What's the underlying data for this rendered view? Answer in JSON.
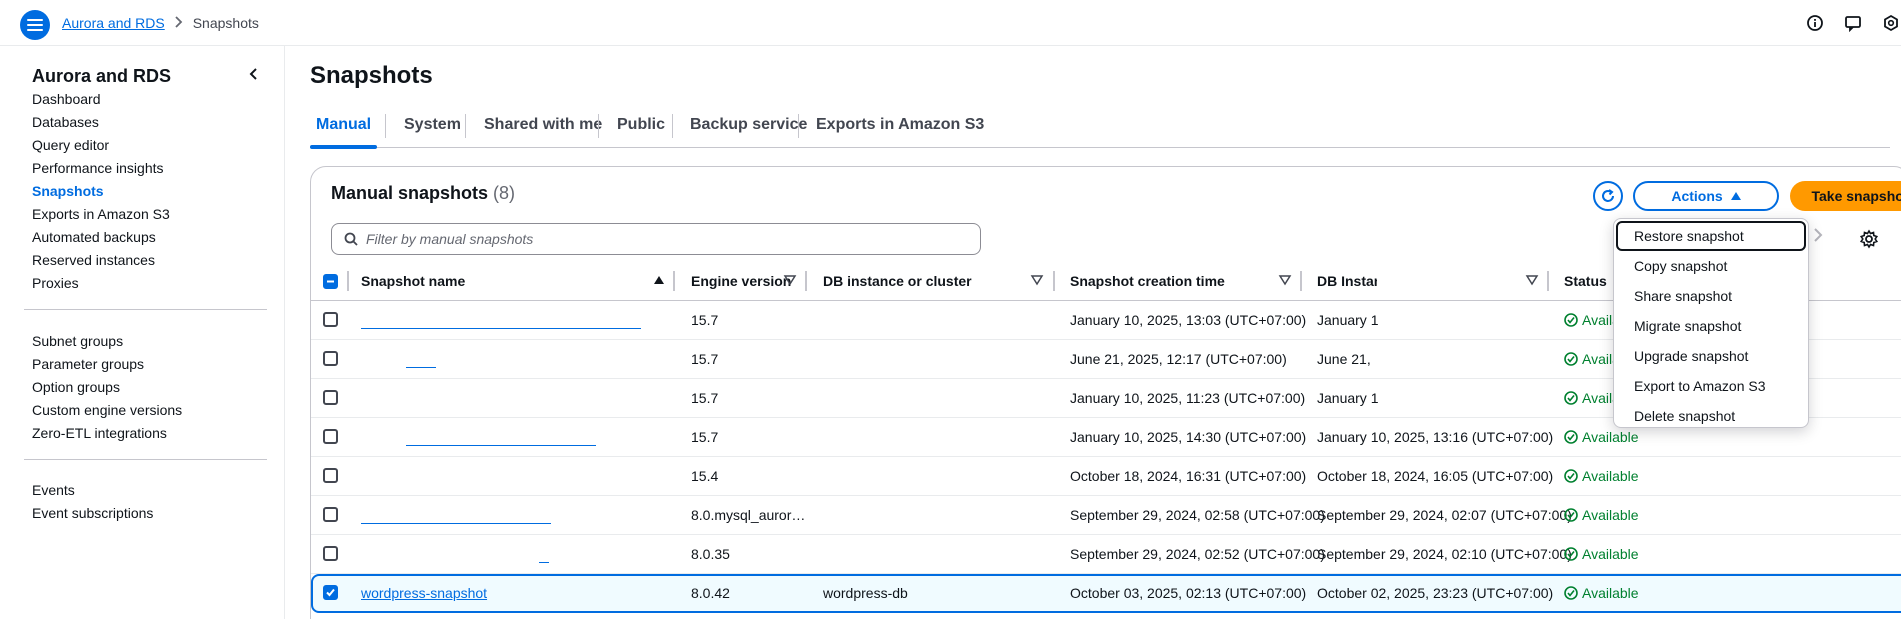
{
  "topbar": {
    "breadcrumb_root": "Aurora and RDS",
    "breadcrumb_current": "Snapshots"
  },
  "sidebar": {
    "title": "Aurora and RDS",
    "items": [
      "Dashboard",
      "Databases",
      "Query editor",
      "Performance insights",
      "Snapshots",
      "Exports in Amazon S3",
      "Automated backups",
      "Reserved instances",
      "Proxies",
      "Subnet groups",
      "Parameter groups",
      "Option groups",
      "Custom engine versions",
      "Zero-ETL integrations",
      "Events",
      "Event subscriptions"
    ],
    "active": "Snapshots"
  },
  "page": {
    "title": "Snapshots",
    "tabs": [
      "Manual",
      "System",
      "Shared with me",
      "Public",
      "Backup service",
      "Exports in Amazon S3"
    ],
    "active_tab": "Manual"
  },
  "panel": {
    "title": "Manual snapshots",
    "count": "(8)",
    "actions_label": "Actions",
    "take_label": "Take snapshot",
    "filter_placeholder": "Filter by manual snapshots"
  },
  "table": {
    "columns": [
      "Snapshot name",
      "Engine version",
      "DB instance or cluster",
      "Snapshot creation time",
      "DB Instance created time",
      "Status"
    ],
    "rows": [
      {
        "name": "",
        "engine": "15.7",
        "db": "",
        "created": "January 10, 2025, 13:03 (UTC+07:00)",
        "db_created": "January 1",
        "status": "Available",
        "checked": false
      },
      {
        "name": "",
        "engine": "15.7",
        "db": "",
        "created": "June 21, 2025, 12:17 (UTC+07:00)",
        "db_created": "June 21,",
        "status": "Available",
        "checked": false
      },
      {
        "name": "",
        "engine": "15.7",
        "db": "",
        "created": "January 10, 2025, 11:23 (UTC+07:00)",
        "db_created": "January 1",
        "status": "Available",
        "checked": false
      },
      {
        "name": "",
        "engine": "15.7",
        "db": "",
        "created": "January 10, 2025, 14:30 (UTC+07:00)",
        "db_created": "January 10, 2025, 13:16 (UTC+07:00)",
        "status": "Available",
        "checked": false
      },
      {
        "name": "",
        "engine": "15.4",
        "db": "",
        "created": "October 18, 2024, 16:31 (UTC+07:00)",
        "db_created": "October 18, 2024, 16:05 (UTC+07:00)",
        "status": "Available",
        "checked": false
      },
      {
        "name": "",
        "engine": "8.0.mysql_auror…",
        "db": "",
        "created": "September 29, 2024, 02:58 (UTC+07:00)",
        "db_created": "September 29, 2024, 02:07 (UTC+07:00)",
        "status": "Available",
        "checked": false
      },
      {
        "name": "",
        "engine": "8.0.35",
        "db": "",
        "created": "September 29, 2024, 02:52 (UTC+07:00)",
        "db_created": "September 29, 2024, 02:10 (UTC+07:00)",
        "status": "Available",
        "checked": false
      },
      {
        "name": "wordpress-snapshot",
        "engine": "8.0.42",
        "db": "wordpress-db",
        "created": "October 03, 2025, 02:13 (UTC+07:00)",
        "db_created": "October 02, 2025, 23:23 (UTC+07:00)",
        "status": "Available",
        "checked": true
      }
    ]
  },
  "actions_menu": [
    "Restore snapshot",
    "Copy snapshot",
    "Share snapshot",
    "Migrate snapshot",
    "Upgrade snapshot",
    "Export to Amazon S3",
    "Delete snapshot"
  ],
  "colors": {
    "accent": "#006ce0",
    "primary_button": "#ff9900",
    "success": "#00802f"
  },
  "icons": {
    "menu": "hamburger-icon",
    "info": "info-icon",
    "feedback": "feedback-icon",
    "settings": "gear-icon",
    "refresh": "refresh-icon",
    "search": "search-icon",
    "status": "check-circle-icon"
  }
}
